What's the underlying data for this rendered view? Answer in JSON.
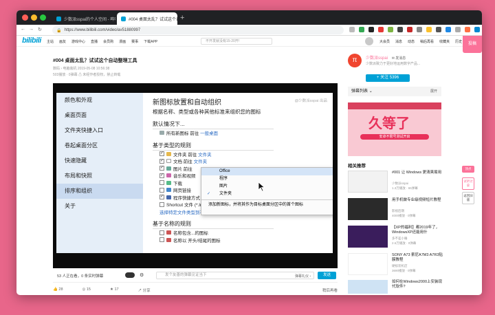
{
  "browser": {
    "tabs": [
      {
        "title": "少数派sspai的个人空间 - 哔哩哔哩",
        "active": false
      },
      {
        "title": "#004 桌面太乱？试试这个自动整",
        "active": true
      }
    ],
    "url": "https://www.bilibili.com/video/av51880997"
  },
  "site": {
    "logo": "bilibili",
    "nav": [
      "主站",
      "画友",
      "游戏中心",
      "直播",
      "会员购",
      "漫画",
      "赛事",
      "下载APP"
    ],
    "search_placeholder": "不开发就没有15-20开!",
    "right_nav": [
      "大会员",
      "消息",
      "动态",
      "稍后再看",
      "收藏夹",
      "历史"
    ],
    "upload_label": "投稿"
  },
  "video": {
    "title": "#004 桌面太乱？试试这个自动整理工具",
    "meta1": "数码 › 电脑装机    2019-05-08 10:56:38",
    "meta2": "503播放 · 0弹幕    ⚠ 未经作者授权，禁止转载"
  },
  "screen": {
    "sidebar_items": [
      "颜色和外观",
      "桌面页面",
      "文件夹快捷入口",
      "卷起桌面分区",
      "快速隐藏",
      "布局和快照",
      "排序和组织",
      "关于"
    ],
    "selected_index": 6,
    "heading": "新图标放置和自动组织",
    "subheading": "根据名称、类型或各种其他标准来组织您的图标",
    "watermark": "@少数派sspai  出品",
    "section_default": "默认情况下...",
    "default_row": "所有新图标 前往",
    "default_link": "一般桌面",
    "section_type": "基于类型的规则",
    "type_rows": [
      {
        "label": "文件夹 前往",
        "link": "文件夹",
        "checked": "✓"
      },
      {
        "label": "文档 前往",
        "link": "文件夹",
        "checked": "✓"
      },
      {
        "label": "图片 前往",
        "link": "",
        "checked": "✓"
      },
      {
        "label": "音乐和视频",
        "link": "",
        "checked": "✓"
      },
      {
        "label": "下载",
        "link": "",
        "checked": ""
      },
      {
        "label": "网页链接",
        "link": "",
        "checked": ""
      },
      {
        "label": "程序快捷方式",
        "link": "",
        "checked": "✓"
      },
      {
        "label": "Shortcut 文件 (*.lnk)",
        "link": "",
        "checked": ""
      }
    ],
    "type_link": "选择特定文件类型到不同的位置",
    "section_name": "基于名称的规则",
    "name_rows": [
      "名称包含...的图标",
      "名称以 开头/结尾的图标"
    ],
    "context_menu": {
      "items": [
        "Office",
        "程序",
        "图片",
        "文件夹"
      ],
      "highlighted": "Office",
      "checked": "文件夹",
      "footer": "添加新图标，并将其作为目标桌面分区中的首个图标"
    }
  },
  "danmaku_bar": {
    "viewers": "53 人正在看，0 条实时弹幕",
    "placeholder": "发个友善的弹幕见证当下",
    "etiquette": "弹幕礼仪 ›",
    "send": "发送"
  },
  "actions": [
    "28",
    "15",
    "17",
    "分享"
  ],
  "actions_right": "稍后再看",
  "uploader": {
    "avatar_letter": "π",
    "name": "少数派sspai",
    "message": "✉ 发消息",
    "desc": "少数派致力于更好地运用数字产品...",
    "follow": "+ 关注 5396"
  },
  "danmaku_list": {
    "title": "弹幕列表",
    "expand": "展开"
  },
  "ad": {
    "headline": "久等了",
    "banner": "安卓不限号测试开启"
  },
  "recommend": {
    "title": "相关推荐",
    "items": [
      {
        "title": "#001 让 Windows 更清爽易用",
        "author": "少数派sspai",
        "views": "1.3万播放 · 65弹幕",
        "color": "#f2f2f2"
      },
      {
        "title": "用手机做专业级视频短片教程",
        "author": "影视后期",
        "views": "4000播放 · 0弹幕",
        "color": "#2a2a2a"
      },
      {
        "title": "【XP的福利】都2019年了，WindowsXP还能用什",
        "author": "多不差小睡",
        "views": "2.6万播放 · 0弹幕",
        "color": "#3a1d5c"
      },
      {
        "title": "SONY A73 索尼A7M3 A7R3贴膜教程",
        "author": "硬核装机店",
        "views": "3690播放 · 0弹幕",
        "color": "#ffffff"
      },
      {
        "title": "如何在Windows2000上安装现代软件?",
        "author": "",
        "views": "",
        "color": "#cfe3f4"
      }
    ]
  },
  "float_buttons": [
    "顶点",
    "试听讨拿",
    "返回旧版"
  ],
  "colors": {
    "accent": "#00a1d6",
    "pink": "#fb7299",
    "background": "#e8668a"
  }
}
